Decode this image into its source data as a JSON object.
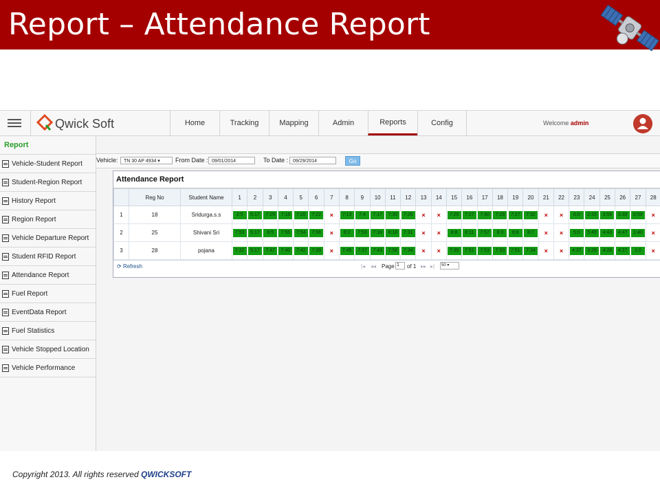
{
  "slide": {
    "title": "Report – Attendance Report"
  },
  "app": {
    "brand": "Qwick Soft",
    "nav": [
      "Home",
      "Tracking",
      "Mapping",
      "Admin",
      "Reports",
      "Config"
    ],
    "active_nav": "Reports",
    "welcome_text": "Welcome",
    "welcome_user": "admin"
  },
  "sidebar": {
    "header": "Report",
    "items": [
      "Vehicle-Student Report",
      "Student-Region Report",
      "History Report",
      "Region Report",
      "Vehicle Departure Report",
      "Student RFID Report",
      "Attendance Report",
      "Fuel Report",
      "EventData Report",
      "Fuel Statistics",
      "Vehicle Stopped Location",
      "Vehicle Performance"
    ]
  },
  "filters": {
    "vehicle_label": "Vehicle:",
    "vehicle_value": "TN 30 AP 4934",
    "from_label": "From Date :",
    "from_value": "09/01/2014",
    "to_label": "To Date :",
    "to_value": "09/29/2014",
    "go": "Go"
  },
  "report": {
    "title": "Attendance Report",
    "col_reg": "Reg No",
    "col_name": "Student Name",
    "days": [
      "1",
      "2",
      "3",
      "4",
      "5",
      "6",
      "7",
      "8",
      "9",
      "10",
      "11",
      "12",
      "13",
      "14",
      "15",
      "16",
      "17",
      "18",
      "19",
      "20",
      "21",
      "22",
      "23",
      "24",
      "25",
      "26",
      "27",
      "28"
    ],
    "rows": [
      {
        "n": "1",
        "reg": "18",
        "name": "Sridurga.s.s",
        "cells": [
          "2:5",
          "5:17",
          "7:29",
          "7:18",
          "7:20",
          "7:22",
          "x",
          "7:13",
          "7:4",
          "7:17",
          "7:30",
          "7:26",
          "x",
          "x",
          "7:25",
          "7:27",
          "7:30",
          "7:26",
          "7:27",
          "7:32",
          "x",
          "x",
          "6:0",
          "2:15",
          "3:59",
          "3:39",
          "0:59",
          "x"
        ]
      },
      {
        "n": "2",
        "reg": "25",
        "name": "Shivani Sri",
        "cells": [
          "7:53",
          "5:17",
          "8:5",
          "7:55",
          "7:54",
          "7:56",
          "x",
          "8:2",
          "7:53",
          "7:18",
          "8:18",
          "7:31",
          "x",
          "x",
          "8:8",
          "8:11",
          "7:57",
          "8:3",
          "8:8",
          "8:7",
          "x",
          "x",
          "5:0",
          "5:49",
          "4:43",
          "4:47",
          "1:40",
          "x"
        ]
      },
      {
        "n": "3",
        "reg": "28",
        "name": "pojana",
        "cells": [
          "7:32",
          "5:17",
          "7:47",
          "7:40",
          "7:42",
          "7:39",
          "x",
          "7:45",
          "7:37",
          "7:43",
          "7:56",
          "7:34",
          "x",
          "x",
          "7:39",
          "7:51",
          "7:53",
          "7:50",
          "7:51",
          "7:34",
          "x",
          "x",
          "4:37",
          "3:28",
          "4:28",
          "4:27",
          "1:0",
          "x"
        ]
      }
    ],
    "refresh": "Refresh",
    "page_label": "Page",
    "page_value": "1",
    "page_of": "of 1",
    "page_size": "50"
  },
  "footer": {
    "text": "Copyright 2013. All rights reserved",
    "brand": "QWICKSOFT"
  },
  "colors": {
    "brand_red": "#a50000",
    "present_green": "#139b13",
    "absent_red": "#c00000"
  }
}
